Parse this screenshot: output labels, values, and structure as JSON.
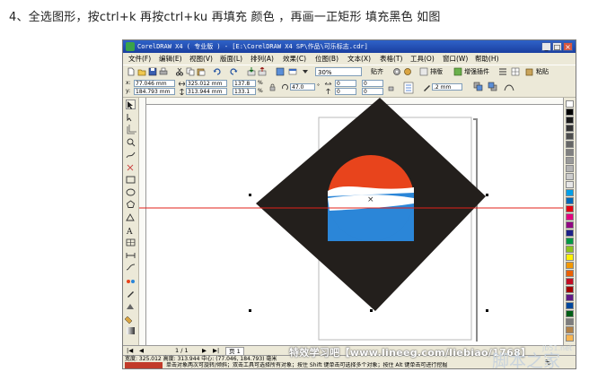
{
  "instruction": "4、全选图形，按ctrl+k 再按ctrl+ku 再填充 颜色 ，再画一正矩形 填充黑色 如图",
  "window": {
    "title": "CorelDRAW X4 ( 专业版 ) - [E:\\CorelDRAW X4 SP\\作品\\可乐标志.cdr]",
    "controls": [
      "_",
      "□",
      "×"
    ]
  },
  "menu": [
    "文件(F)",
    "编辑(E)",
    "视图(V)",
    "版面(L)",
    "排列(A)",
    "效果(C)",
    "位图(B)",
    "文本(X)",
    "表格(T)",
    "工具(O)",
    "窗口(W)",
    "帮助(H)"
  ],
  "toolbar": {
    "zoom": "30%",
    "snap_label": "贴齐",
    "launcher_label": "启动器",
    "extra_label": "排版",
    "plugin_label": "增强插件",
    "paste_label": "粘贴",
    "icons": [
      "new-icon",
      "open-icon",
      "save-icon",
      "print-icon",
      "cut-icon",
      "copy-icon",
      "paste-icon",
      "undo-icon",
      "redo-icon",
      "import-icon",
      "export-icon"
    ]
  },
  "property_bar": {
    "x": "77.046 mm",
    "y": "184.793 mm",
    "width": "325.012 mm",
    "height": "313.944 mm",
    "scale_x": "137.8",
    "scale_y": "133.1",
    "angle": "47.0",
    "corner1": "0",
    "corner2": "0",
    "corner3": "0",
    "corner4": "0",
    "outline": ".2 mm"
  },
  "tools": [
    "pick-tool-icon",
    "shape-tool-icon",
    "crop-tool-icon",
    "zoom-tool-icon",
    "freehand-tool-icon",
    "smart-fill-icon",
    "rectangle-tool-icon",
    "ellipse-tool-icon",
    "polygon-tool-icon",
    "basic-shapes-icon",
    "text-tool-icon",
    "table-tool-icon",
    "parallel-dimension-icon",
    "connector-icon",
    "blend-tool-icon",
    "eyedropper-icon",
    "outline-tool-icon",
    "fill-tool-icon",
    "interactive-fill-icon"
  ],
  "palette": [
    "#ffffff",
    "#000000",
    "#1a1a1a",
    "#333333",
    "#4d4d4d",
    "#666666",
    "#808080",
    "#999999",
    "#b3b3b3",
    "#cccccc",
    "#e6e6e6",
    "#00a0e9",
    "#0068b7",
    "#e60012",
    "#e4007f",
    "#920783",
    "#1d2088",
    "#009944",
    "#8fc31f",
    "#fff100",
    "#f39800",
    "#eb6100",
    "#c30d23",
    "#a40000",
    "#601986",
    "#00479d",
    "#005e15",
    "#7d7d7d",
    "#b28146",
    "#f8b551"
  ],
  "page_nav": {
    "position": "1 / 1",
    "tab": "页 1"
  },
  "status": {
    "line1": "宽度: 325.012 高度: 313.944 中心: (77.046, 184.793) 毫米",
    "line2": "单击对象两次可旋转/倾斜；双击工具可选择所有对象；按住 Shift 键单击可选择多个对象；按住 Alt 键单击可进行挖掘",
    "fill_label": "无"
  },
  "watermark": {
    "line1": "特效学习吧【www.lineeg.com/liebiao/1768】",
    "line2": "脚本之家",
    "site": "jb51.net"
  },
  "colors": {
    "logo_red": "#e8441c",
    "logo_blue": "#2b86d8",
    "diamond": "#231f1c",
    "guide": "#e1201a"
  }
}
